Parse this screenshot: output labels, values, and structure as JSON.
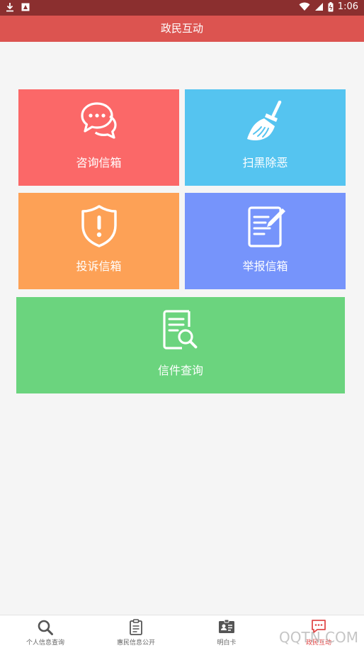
{
  "status_bar": {
    "time": "1:06",
    "icons": [
      "download-icon",
      "image-icon",
      "wifi-icon",
      "signal-icon",
      "battery-icon"
    ]
  },
  "app_bar": {
    "title": "政民互动"
  },
  "tiles": [
    {
      "label": "咨询信箱",
      "icon": "chat-bubbles-icon",
      "color": "#fb6868"
    },
    {
      "label": "扫黑除恶",
      "icon": "broom-icon",
      "color": "#55c4f0"
    },
    {
      "label": "投诉信箱",
      "icon": "shield-alert-icon",
      "color": "#fda156"
    },
    {
      "label": "举报信箱",
      "icon": "document-edit-icon",
      "color": "#7694fb"
    },
    {
      "label": "信件查询",
      "icon": "document-search-icon",
      "color": "#6bd47e"
    }
  ],
  "bottom_nav": [
    {
      "label": "个人信息查询",
      "icon": "search-icon"
    },
    {
      "label": "惠民信息公开",
      "icon": "clipboard-icon"
    },
    {
      "label": "明白卡",
      "icon": "id-card-icon"
    },
    {
      "label": "政民互动",
      "icon": "message-icon",
      "active": true
    }
  ],
  "watermark": "QQTN.COM"
}
